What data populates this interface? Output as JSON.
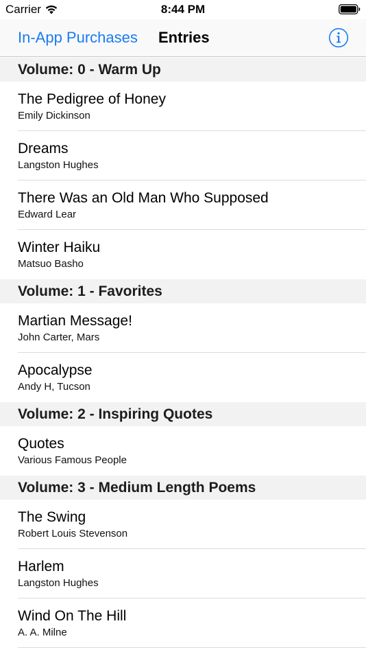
{
  "status": {
    "carrier": "Carrier",
    "time": "8:44 PM"
  },
  "nav": {
    "left_label": "In-App Purchases",
    "title": "Entries",
    "info_icon": "info-circle-icon",
    "accent": "#1a7bf2"
  },
  "sections": [
    {
      "header": "Volume: 0 - Warm Up",
      "rows": [
        {
          "title": "The Pedigree of Honey",
          "subtitle": "Emily Dickinson"
        },
        {
          "title": "Dreams",
          "subtitle": "Langston Hughes"
        },
        {
          "title": "There Was an Old Man Who Supposed",
          "subtitle": "Edward Lear"
        },
        {
          "title": "Winter Haiku",
          "subtitle": "Matsuo Basho"
        }
      ]
    },
    {
      "header": "Volume: 1 - Favorites",
      "rows": [
        {
          "title": "Martian Message!",
          "subtitle": "John Carter, Mars"
        },
        {
          "title": "Apocalypse",
          "subtitle": "Andy H, Tucson"
        }
      ]
    },
    {
      "header": "Volume: 2 - Inspiring Quotes",
      "rows": [
        {
          "title": "Quotes",
          "subtitle": "Various Famous People"
        }
      ]
    },
    {
      "header": "Volume: 3 - Medium Length Poems",
      "rows": [
        {
          "title": "The Swing",
          "subtitle": "Robert Louis Stevenson"
        },
        {
          "title": "Harlem",
          "subtitle": "Langston Hughes"
        },
        {
          "title": "Wind On The Hill",
          "subtitle": "A. A. Milne"
        }
      ]
    }
  ]
}
